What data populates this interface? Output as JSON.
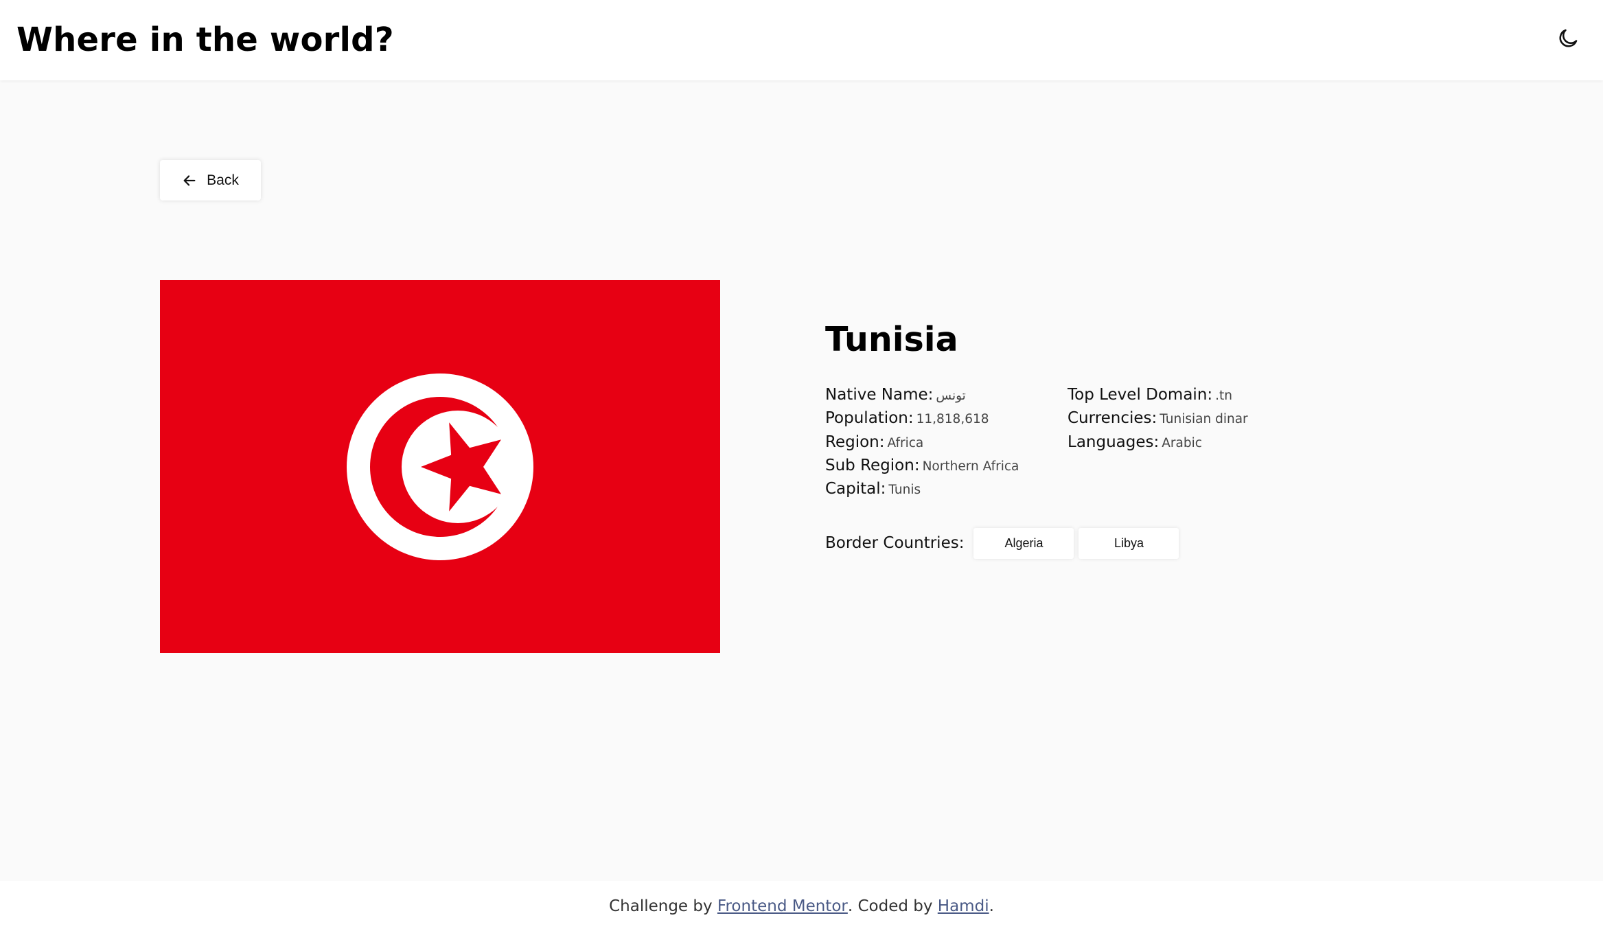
{
  "header": {
    "title": "Where in the world?",
    "theme_icon": "moon-icon"
  },
  "back_button": {
    "label": "Back",
    "icon": "arrow-left-icon"
  },
  "country": {
    "name": "Tunisia",
    "flag": {
      "background": "#e70013",
      "emblem": "white disc with red crescent and star"
    },
    "details_left": [
      {
        "label": "Native Name:",
        "value": "تونس"
      },
      {
        "label": "Population:",
        "value": "11,818,618"
      },
      {
        "label": "Region:",
        "value": "Africa"
      },
      {
        "label": "Sub Region:",
        "value": "Northern Africa"
      },
      {
        "label": "Capital:",
        "value": "Tunis"
      }
    ],
    "details_right": [
      {
        "label": "Top Level Domain:",
        "value": ".tn"
      },
      {
        "label": "Currencies:",
        "value": "Tunisian dinar"
      },
      {
        "label": "Languages:",
        "value": "Arabic"
      }
    ],
    "border_label": "Border Countries:",
    "borders": [
      "Algeria",
      "Libya"
    ]
  },
  "footer": {
    "prefix": "Challenge by ",
    "link1": "Frontend Mentor",
    "middle": ". Coded by ",
    "link2": "Hamdi",
    "suffix": "."
  },
  "colors": {
    "background": "#fafafa",
    "surface": "#ffffff",
    "flag_red": "#e70013",
    "link": "#4a5a86"
  }
}
